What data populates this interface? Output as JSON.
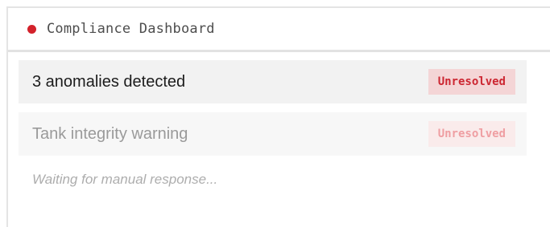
{
  "header": {
    "title": "Compliance Dashboard",
    "status_color": "#d3222b"
  },
  "alerts": [
    {
      "text": "3 anomalies detected",
      "badge": "Unresolved",
      "state": "active"
    },
    {
      "text": "Tank integrity warning",
      "badge": "Unresolved",
      "state": "dimmed"
    }
  ],
  "footer": {
    "status_message": "Waiting for manual response..."
  },
  "colors": {
    "accent_red": "#d3222b",
    "badge_bg": "#f4d5d6",
    "badge_bg_dimmed": "#faebeb"
  }
}
